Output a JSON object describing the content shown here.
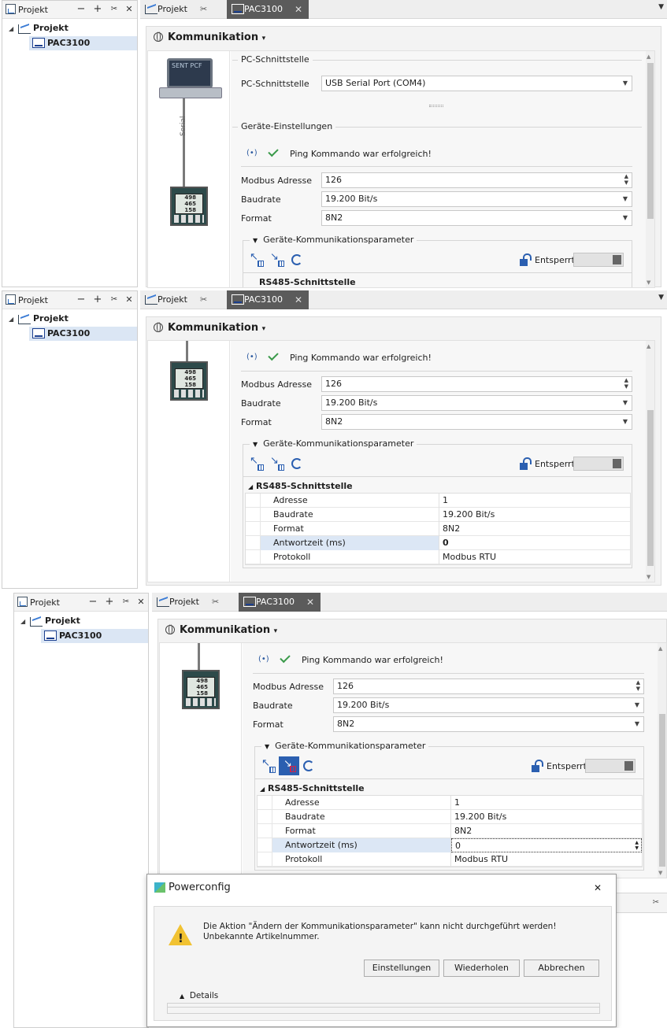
{
  "project_panel": {
    "title": "Projekt",
    "root": "Projekt",
    "device": "PAC3100",
    "btn_minimize": "−",
    "btn_add": "+",
    "btn_pin": "✂",
    "btn_close": "✕"
  },
  "tabs": [
    {
      "label": "Projekt",
      "pin": "✂"
    },
    {
      "label": "PAC3100",
      "close": "✕"
    }
  ],
  "header": {
    "title": "Kommunikation",
    "chevron": "▾"
  },
  "pc_interface": {
    "group_label": "PC-Schnittstelle",
    "field_label": "PC-Schnittstelle",
    "value": "USB Serial Port (COM4)"
  },
  "device_settings": {
    "group_label": "Geräte-Einstellungen",
    "ping_message": "Ping Kommando war erfolgreich!",
    "modbus_label": "Modbus Adresse",
    "modbus_value": "126",
    "baud_label": "Baudrate",
    "baud_value": "19.200 Bit/s",
    "format_label": "Format",
    "format_value": "8N2"
  },
  "comm_params": {
    "group_label": "Geräte-Kommunikationsparameter",
    "lock_label": "Entsperrt",
    "section": "RS485-Schnittstelle",
    "rows": [
      {
        "key": "Adresse",
        "value": "1"
      },
      {
        "key": "Baudrate",
        "value": "19.200 Bit/s"
      },
      {
        "key": "Format",
        "value": "8N2"
      },
      {
        "key": "Antwortzeit (ms)",
        "value": "0"
      },
      {
        "key": "Protokoll",
        "value": "Modbus RTU"
      }
    ]
  },
  "illustration": {
    "cable_label": "Serial",
    "laptop_text": "SENT PCF"
  },
  "device_display": [
    "498",
    "465",
    "158"
  ],
  "dialog": {
    "title": "Powerconfig",
    "close": "✕",
    "message": "Die Aktion \"Ändern der Kommunikationsparameter\" kann nicht durchgeführt werden! Unbekannte Artikelnummer.",
    "buttons": [
      "Einstellungen",
      "Wiederholen",
      "Abbrechen"
    ],
    "details": "Details"
  },
  "icons": {
    "caret_expanded": "◢",
    "caret_up": "▲",
    "caret_down": "▼",
    "signal": "(•)"
  }
}
